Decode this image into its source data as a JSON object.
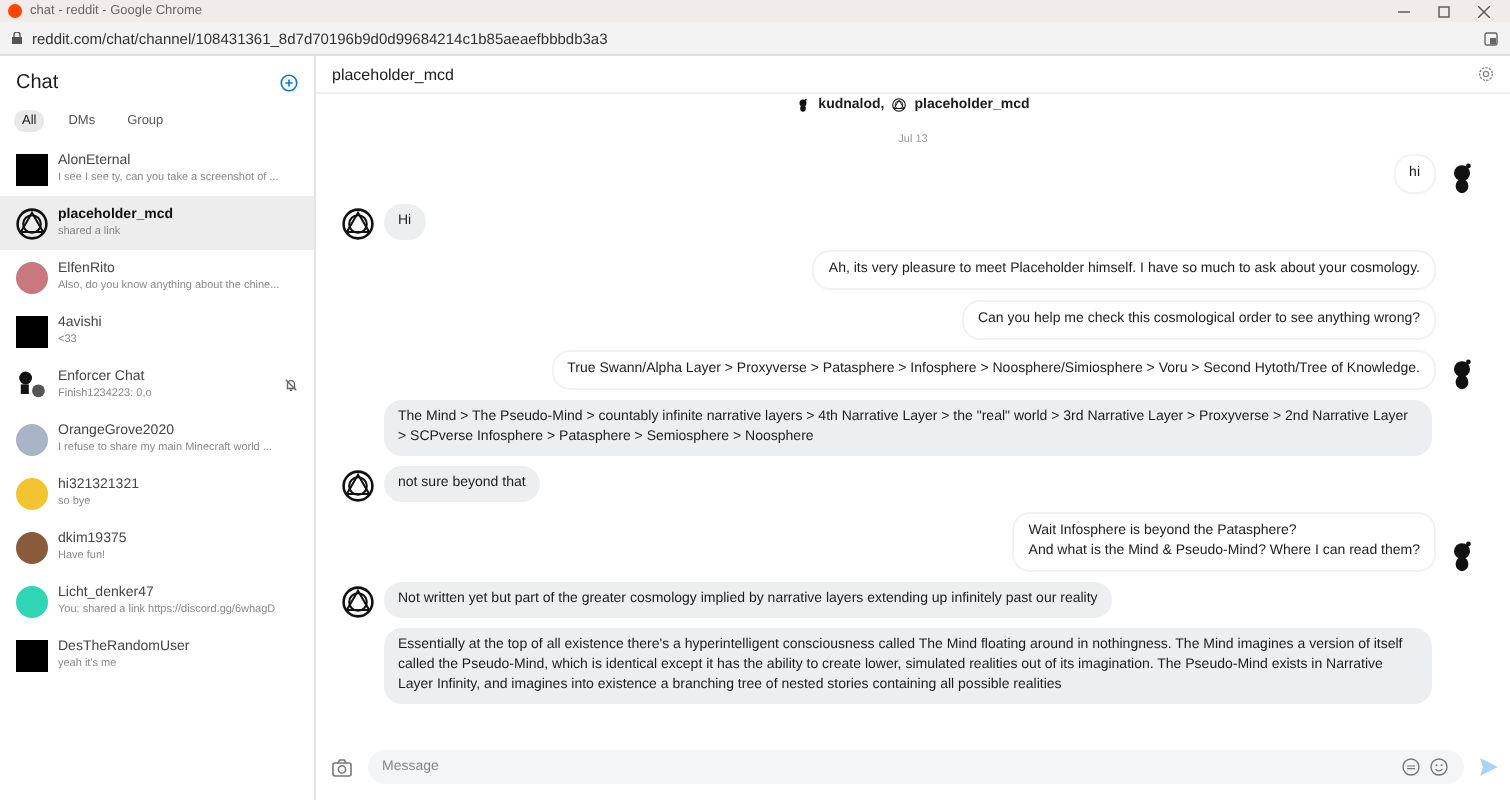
{
  "window": {
    "title": "chat - reddit - Google Chrome"
  },
  "address_bar": {
    "url": "reddit.com/chat/channel/108431361_8d7d70196b9d0d99684214c1b85aeaefbbbdb3a3"
  },
  "sidebar": {
    "title": "Chat",
    "tabs": [
      {
        "label": "All",
        "selected": true
      },
      {
        "label": "DMs",
        "selected": false
      },
      {
        "label": "Group",
        "selected": false
      }
    ],
    "items": [
      {
        "name": "AlonEternal",
        "preview": "I see I see ty, can you take a screenshot of ...",
        "kind": "nsfw",
        "selected": false,
        "muted": false
      },
      {
        "name": "placeholder_mcd",
        "preview": "shared a link",
        "kind": "emblem",
        "selected": true,
        "muted": false
      },
      {
        "name": "ElfenRito",
        "preview": "Also, do you know anything about the chine...",
        "kind": "circle",
        "color": "#c9787e",
        "selected": false,
        "muted": false
      },
      {
        "name": "4avishi",
        "preview": "<33",
        "kind": "nsfw",
        "selected": false,
        "muted": false
      },
      {
        "name": "Enforcer Chat",
        "preview": "Finish1234223: 0,o",
        "kind": "group",
        "selected": false,
        "muted": true
      },
      {
        "name": "OrangeGrove2020",
        "preview": "I refuse to share my main Minecraft world ...",
        "kind": "circle",
        "color": "#a9b4c6",
        "selected": false,
        "muted": false
      },
      {
        "name": "hi321321321",
        "preview": "so bye",
        "kind": "circle",
        "color": "#f2c530",
        "selected": false,
        "muted": false
      },
      {
        "name": "dkim19375",
        "preview": "Have fun!",
        "kind": "circle",
        "color": "#8a5a3c",
        "selected": false,
        "muted": false
      },
      {
        "name": "Licht_denker47",
        "preview": "You: shared a link https://discord.gg/6whagD",
        "kind": "circle",
        "color": "#2fd6b4",
        "selected": false,
        "muted": false
      },
      {
        "name": "DesTheRandomUser",
        "preview": "yeah it's me",
        "kind": "nsfw",
        "selected": false,
        "muted": false
      }
    ]
  },
  "chat": {
    "title": "placeholder_mcd",
    "participants": [
      {
        "name": "kudnalod,",
        "kind": "snoo"
      },
      {
        "name": "placeholder_mcd",
        "kind": "emblem"
      }
    ],
    "date": "Jul 13",
    "messages": [
      {
        "kind": "out",
        "text": "hi",
        "avatar": true
      },
      {
        "kind": "in",
        "text": "Hi",
        "avatar": true
      },
      {
        "kind": "out",
        "text": "Ah, its very pleasure to meet Placeholder himself. I have so much to ask about your cosmology.",
        "avatar": false
      },
      {
        "kind": "out",
        "text": "Can you help me check this cosmological order to see anything wrong?",
        "avatar": false
      },
      {
        "kind": "out",
        "text": "True Swann/Alpha Layer > Proxyverse > Patasphere > Infosphere > Noosphere/Simiosphere > Voru > Second Hytoth/Tree of Knowledge.",
        "avatar": true
      },
      {
        "kind": "in",
        "text": "The Mind > The Pseudo-Mind > countably infinite narrative layers > 4th Narrative Layer > the \"real\" world > 3rd Narrative Layer > Proxyverse > 2nd Narrative Layer > SCPverse Infosphere > Patasphere > Semiosphere > Noosphere",
        "avatar": false
      },
      {
        "kind": "in",
        "text": "not sure beyond that",
        "avatar": true
      },
      {
        "kind": "out",
        "text": "Wait Infosphere is beyond the Patasphere?\nAnd what is the Mind & Pseudo-Mind? Where I can read them?",
        "avatar": true
      },
      {
        "kind": "in",
        "text": "Not written yet but part of the greater cosmology implied by narrative layers extending up infinitely past our reality",
        "avatar": true
      },
      {
        "kind": "in",
        "text": "Essentially at the top of all existence there's a hyperintelligent consciousness called The Mind floating around in nothingness. The Mind imagines a version of itself called the Pseudo-Mind, which is identical except it has the ability to create lower, simulated realities out of its imagination. The Pseudo-Mind exists in Narrative Layer Infinity, and imagines into existence a branching tree of nested stories containing all possible realities",
        "avatar": false
      }
    ]
  },
  "composer": {
    "placeholder": "Message"
  }
}
